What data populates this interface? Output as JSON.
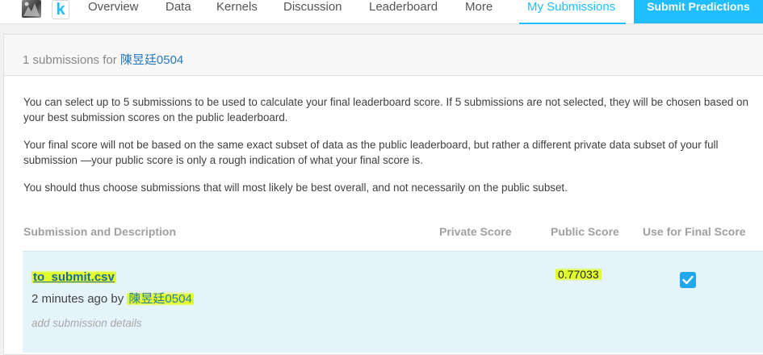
{
  "nav": {
    "logo_letter": "k",
    "tabs": [
      "Overview",
      "Data",
      "Kernels",
      "Discussion",
      "Leaderboard",
      "More"
    ],
    "active_tab": "My Submissions",
    "submit_label": "Submit Predictions"
  },
  "header": {
    "count_text": "1 submissions for",
    "user": "陳昱廷0504"
  },
  "info": [
    "You can select up to 5 submissions to be used to calculate your final leaderboard score. If 5 submissions are not selected, they will be chosen based on your best submission scores on the public leaderboard.",
    "Your final score will not be based on the same exact subset of data as the public leaderboard, but rather a different private data subset of your full submission —your public score is only a rough indication of what your final score is.",
    "You should thus choose submissions that will most likely be best overall, and not necessarily on the public subset."
  ],
  "table": {
    "columns": [
      "Submission and Description",
      "Private Score",
      "Public Score",
      "Use for Final Score"
    ],
    "rows": [
      {
        "file": "to_submit.csv",
        "time_text": "2 minutes ago by",
        "user": "陳昱廷0504",
        "details_placeholder": "add submission details",
        "private_score": "",
        "public_score": "0.77033",
        "use_for_final": true
      }
    ]
  },
  "colors": {
    "accent": "#20beff",
    "highlight": "#e3ff2a",
    "row_bg": "#e5f3fb"
  }
}
